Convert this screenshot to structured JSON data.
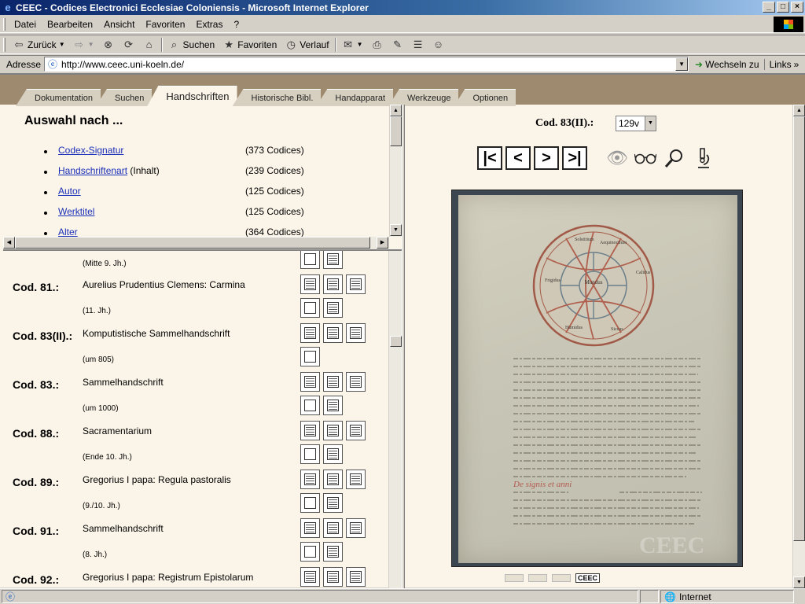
{
  "window": {
    "title": "CEEC - Codices Electronici Ecclesiae Coloniensis - Microsoft Internet Explorer"
  },
  "menu": [
    "Datei",
    "Bearbeiten",
    "Ansicht",
    "Favoriten",
    "Extras",
    "?"
  ],
  "toolbar": {
    "back": "Zurück",
    "search": "Suchen",
    "favorites": "Favoriten",
    "history": "Verlauf"
  },
  "address": {
    "label": "Adresse",
    "url": "http://www.ceec.uni-koeln.de/",
    "go": "Wechseln zu",
    "links": "Links"
  },
  "tabs": [
    "Dokumentation",
    "Suchen",
    "Handschriften",
    "Historische Bibl.",
    "Handapparat",
    "Werkzeuge",
    "Optionen"
  ],
  "active_tab": "Handschriften",
  "selection": {
    "heading": "Auswahl nach ...",
    "items": [
      {
        "link": "Codex-Signatur",
        "suffix": "",
        "count": "(373 Codices)"
      },
      {
        "link": "Handschriftenart",
        "suffix": " (Inhalt)",
        "count": "(239 Codices)"
      },
      {
        "link": "Autor",
        "suffix": "",
        "count": "(125 Codices)"
      },
      {
        "link": "Werktitel",
        "suffix": "",
        "count": "(125 Codices)"
      },
      {
        "link": "Alter",
        "suffix": "",
        "count": "(364 Codices)"
      }
    ]
  },
  "codices": {
    "prev_date": "(Mitte 9. Jh.)",
    "rows": [
      {
        "id": "Cod. 81.:",
        "title": "Aurelius Prudentius Clemens: Carmina",
        "date": "(11. Jh.)"
      },
      {
        "id": "Cod. 83(II).:",
        "title": "Komputistische Sammelhandschrift",
        "date": "(um 805)"
      },
      {
        "id": "Cod. 83.:",
        "title": "Sammelhandschrift",
        "date": "(um 1000)"
      },
      {
        "id": "Cod. 88.:",
        "title": "Sacramentarium",
        "date": "(Ende 10. Jh.)"
      },
      {
        "id": "Cod. 89.:",
        "title": "Gregorius I papa: Regula pastoralis",
        "date": "(9./10. Jh.)"
      },
      {
        "id": "Cod. 91.:",
        "title": "Sammelhandschrift",
        "date": "(8. Jh.)"
      },
      {
        "id": "Cod. 92.:",
        "title": "Gregorius I papa: Registrum Epistolarum",
        "date": ""
      }
    ]
  },
  "viewer": {
    "codex": "Cod. 83(II).:",
    "folio": "129v",
    "watermark": "CEEC",
    "diagram_center": "Mundus",
    "diagram_ring": [
      "Solstitium",
      "Aequinoctium",
      "Calidus",
      "Frigidus",
      "Humidus",
      "Siccus"
    ],
    "rubric": "De signis et anni"
  },
  "status": {
    "zone": "Internet"
  }
}
